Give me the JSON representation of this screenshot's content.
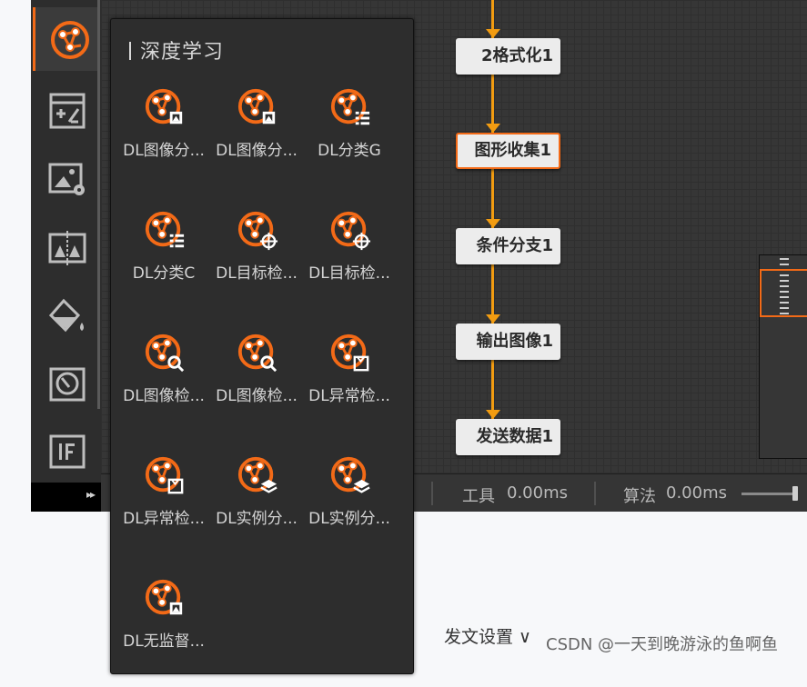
{
  "flow_nodes": [
    {
      "label": "2格式化1",
      "selected": false
    },
    {
      "label": "图形收集1",
      "selected": true
    },
    {
      "label": "条件分支1",
      "selected": false
    },
    {
      "label": "输出图像1",
      "selected": false
    },
    {
      "label": "发送数据1",
      "selected": false
    }
  ],
  "status": {
    "tool_label": "工具",
    "tool_time": "0.00ms",
    "algo_label": "算法",
    "algo_time": "0.00ms"
  },
  "sidebar": {
    "items": [
      {
        "icon": "deep-learning-icon"
      },
      {
        "icon": "calculator-icon"
      },
      {
        "icon": "image-settings-icon"
      },
      {
        "icon": "image-compare-icon"
      },
      {
        "icon": "paint-bucket-icon"
      },
      {
        "icon": "camera-lens-icon"
      },
      {
        "icon": "if-logic-icon"
      }
    ],
    "expand_glyph": "▸▸"
  },
  "popup": {
    "title": "深度学习",
    "tools": [
      {
        "label": "DL图像分...",
        "badge": "image"
      },
      {
        "label": "DL图像分...",
        "badge": "image"
      },
      {
        "label": "DL分类G",
        "badge": "list"
      },
      {
        "label": "DL分类C",
        "badge": "list"
      },
      {
        "label": "DL目标检...",
        "badge": "target"
      },
      {
        "label": "DL目标检...",
        "badge": "target"
      },
      {
        "label": "DL图像检...",
        "badge": "search"
      },
      {
        "label": "DL图像检...",
        "badge": "search"
      },
      {
        "label": "DL异常检...",
        "badge": "box"
      },
      {
        "label": "DL异常检...",
        "badge": "box"
      },
      {
        "label": "DL实例分...",
        "badge": "layers"
      },
      {
        "label": "DL实例分...",
        "badge": "layers"
      },
      {
        "label": "DL无监督...",
        "badge": "image"
      }
    ]
  },
  "page": {
    "publish_settings": "发文设置",
    "watermark": "CSDN @一天到晚游泳的鱼啊鱼"
  },
  "colors": {
    "accent": "#f36a17",
    "flow": "#f29c11",
    "panel": "#2d2d2d"
  }
}
